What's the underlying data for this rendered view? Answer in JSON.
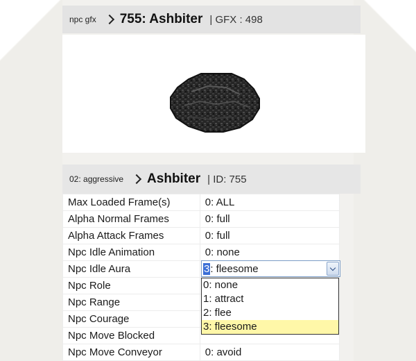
{
  "gfx_header": {
    "crumb": "npc gfx",
    "title": "755: Ashbiter",
    "info": "| GFX : 498"
  },
  "npc_header": {
    "crumb": "02: aggressive",
    "title": "Ashbiter",
    "info": "| ID: 755"
  },
  "sprite": {
    "icon": "ashbiter-sprite-icon",
    "color": "#2a2a2a"
  },
  "properties": [
    {
      "label": "Max Loaded Frame(s)",
      "value": "0: ALL"
    },
    {
      "label": "Alpha Normal Frames",
      "value": "0: full"
    },
    {
      "label": "Alpha Attack Frames",
      "value": "0: full"
    },
    {
      "label": "Npc Idle Animation",
      "value": "0: none"
    },
    {
      "label": "Npc Idle Aura",
      "value": ""
    },
    {
      "label": "Npc Role",
      "value": ""
    },
    {
      "label": "Npc Range",
      "value": ""
    },
    {
      "label": "Npc Courage",
      "value": ""
    },
    {
      "label": "Npc Move Blocked",
      "value": ""
    },
    {
      "label": "Npc Move Conveyor",
      "value": "0: avoid"
    }
  ],
  "idle_aura_select": {
    "selected_prefix": "3",
    "selected_rest": ": fleesome",
    "options": [
      "0: none",
      "1: attract",
      "2: flee",
      "3: fleesome"
    ],
    "highlight_color": "#fff7a8"
  }
}
